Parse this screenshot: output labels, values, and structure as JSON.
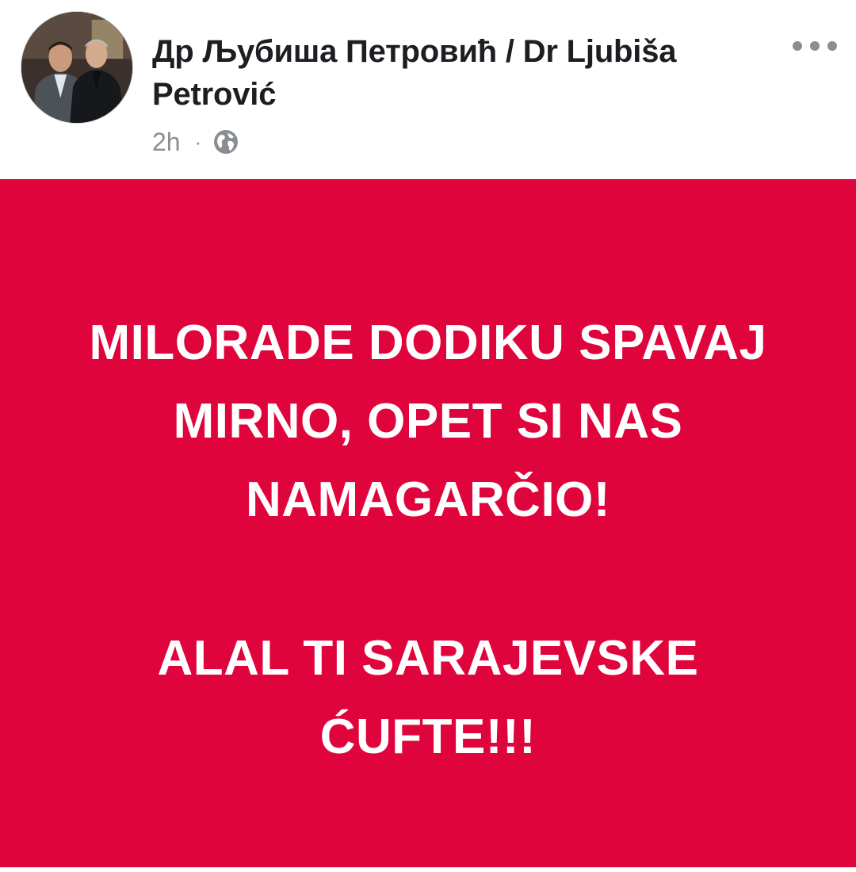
{
  "header": {
    "author_name": "Др Љубиша Петровић / Dr Ljubiša Petrović",
    "timestamp": "2h",
    "separator": "·",
    "audience_icon": "globe-icon",
    "more_icon": "more-options-icon"
  },
  "post": {
    "background_color": "#e0043c",
    "text_color": "#ffffff",
    "line1": "MILORADE DODIKU SPAVAJ\nMIRNO, OPET SI NAS\nNAMAGARČIO!",
    "line2": "ALAL TI SARAJEVSKE\nĆUFTE!!!"
  }
}
